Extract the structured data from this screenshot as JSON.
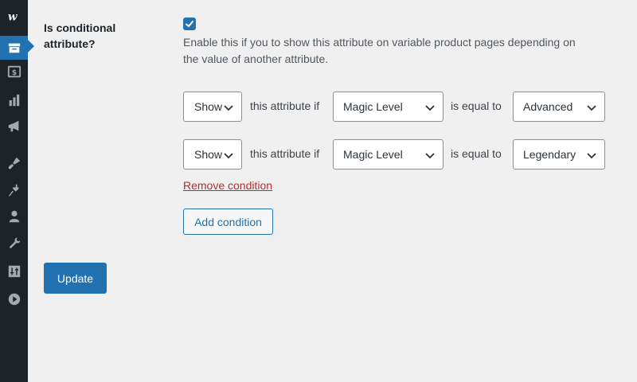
{
  "sidebar": {
    "icons": [
      {
        "name": "woocommerce-logo-icon"
      },
      {
        "name": "products-icon",
        "active": true
      },
      {
        "name": "payments-icon"
      },
      {
        "name": "analytics-icon"
      },
      {
        "name": "marketing-icon"
      },
      {
        "name": "appearance-icon"
      },
      {
        "name": "plugins-icon"
      },
      {
        "name": "users-icon"
      },
      {
        "name": "tools-icon"
      },
      {
        "name": "settings-icon"
      },
      {
        "name": "play-icon"
      }
    ]
  },
  "field": {
    "label": "Is conditional attribute?",
    "checked": true,
    "help": "Enable this if you to show this attribute on variable product pages depending on the value of another attribute."
  },
  "conditions": [
    {
      "action": "Show",
      "text_attr": "this attribute if",
      "attribute": "Magic Level",
      "text_equal": "is equal to",
      "value": "Advanced"
    },
    {
      "action": "Show",
      "text_attr": "this attribute if",
      "attribute": "Magic Level",
      "text_equal": "is equal to",
      "value": "Legendary"
    }
  ],
  "remove_condition_label": "Remove condition",
  "add_condition_label": "Add condition",
  "update_label": "Update",
  "colors": {
    "sidebar": "#1d2327",
    "accent": "#2271b1",
    "danger": "#b32d2e",
    "background": "#f0f0f1"
  }
}
